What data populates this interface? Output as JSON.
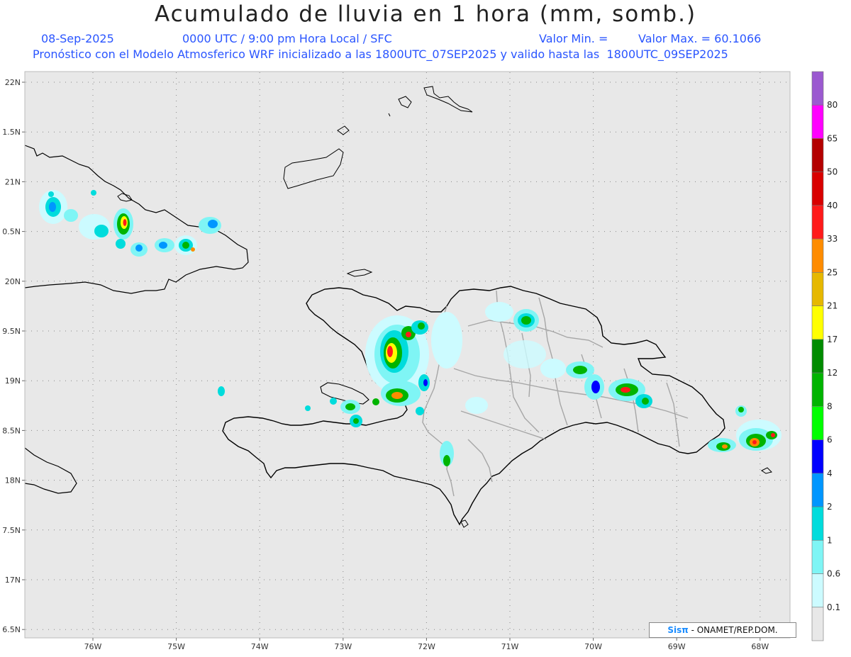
{
  "title": "Acumulado de lluvia en 1 hora (mm, somb.)",
  "header": {
    "date": "08-Sep-2025",
    "time_info": "0000 UTC / 9:00 pm Hora Local / SFC",
    "min_label": "Valor Min. =",
    "max_label": "Valor Max. = 60.1066",
    "model_info": "Pronóstico con el Modelo Atmosferico WRF inicializado a las 1800UTC_07SEP2025 y valido hasta las  1800UTC_09SEP2025"
  },
  "axes": {
    "lat_labels": [
      "22N",
      "1.5N",
      "21N",
      "0.5N",
      "20N",
      "9.5N",
      "19N",
      "8.5N",
      "18N",
      "7.5N",
      "17N",
      "6.5N"
    ],
    "lon_labels": [
      "76W",
      "75W",
      "74W",
      "73W",
      "72W",
      "71W",
      "70W",
      "69W",
      "68W"
    ]
  },
  "colorbar": {
    "labels": [
      "80",
      "65",
      "50",
      "40",
      "33",
      "25",
      "21",
      "17",
      "12",
      "8",
      "6",
      "4",
      "2",
      "1",
      "0.6",
      "0.1"
    ],
    "colors": [
      "#9b59d0",
      "#ff00ff",
      "#b40000",
      "#d90000",
      "#ff1a1a",
      "#ff8c00",
      "#e6b800",
      "#ffff00",
      "#008c00",
      "#00b400",
      "#00ff00",
      "#0000ff",
      "#0096ff",
      "#00dcdc",
      "#7ff5f5",
      "#ccfbff",
      "#e8e8e8"
    ]
  },
  "credit": {
    "brand": "Sisπ",
    "text": "- ONAMET/REP.DOM."
  },
  "colors": {
    "background": "#e8e8e8",
    "coastline": "#000000",
    "province_border": "#a6a6a6",
    "header_blue": "#2a55ff"
  }
}
